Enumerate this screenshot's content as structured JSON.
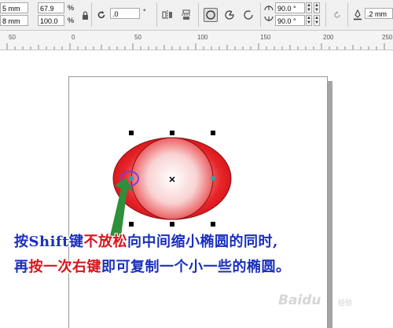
{
  "toolbar": {
    "size_w": "5 mm",
    "size_h": "8 mm",
    "scale_x": "67.9",
    "scale_y": "100.0",
    "percent_unit": "%",
    "rotation": ".0",
    "degree_unit": "°",
    "angle_start": "90.0 °",
    "angle_end": "90.0 °",
    "outline_width": ".2 mm"
  },
  "ruler": {
    "labels": [
      "50",
      "0",
      "50",
      "100",
      "150",
      "200",
      "250"
    ]
  },
  "instruction": {
    "line1_part1": "按Shift键",
    "line1_part2": "不放松",
    "line1_part3": "向中间缩小椭圆的同时,",
    "line2_part1": "再",
    "line2_part2": "按一次右键",
    "line2_part3": "即可复制一个小一些的椭圆。"
  },
  "watermark": {
    "text": "Baidu",
    "sub": "经验"
  },
  "colors": {
    "instruction_blue": "#1a2fbf",
    "instruction_red": "#d8141c",
    "ellipse_red": "#e8262a",
    "arrow_green": "#2f8f3a",
    "highlight_purple": "#7b3fd0"
  }
}
